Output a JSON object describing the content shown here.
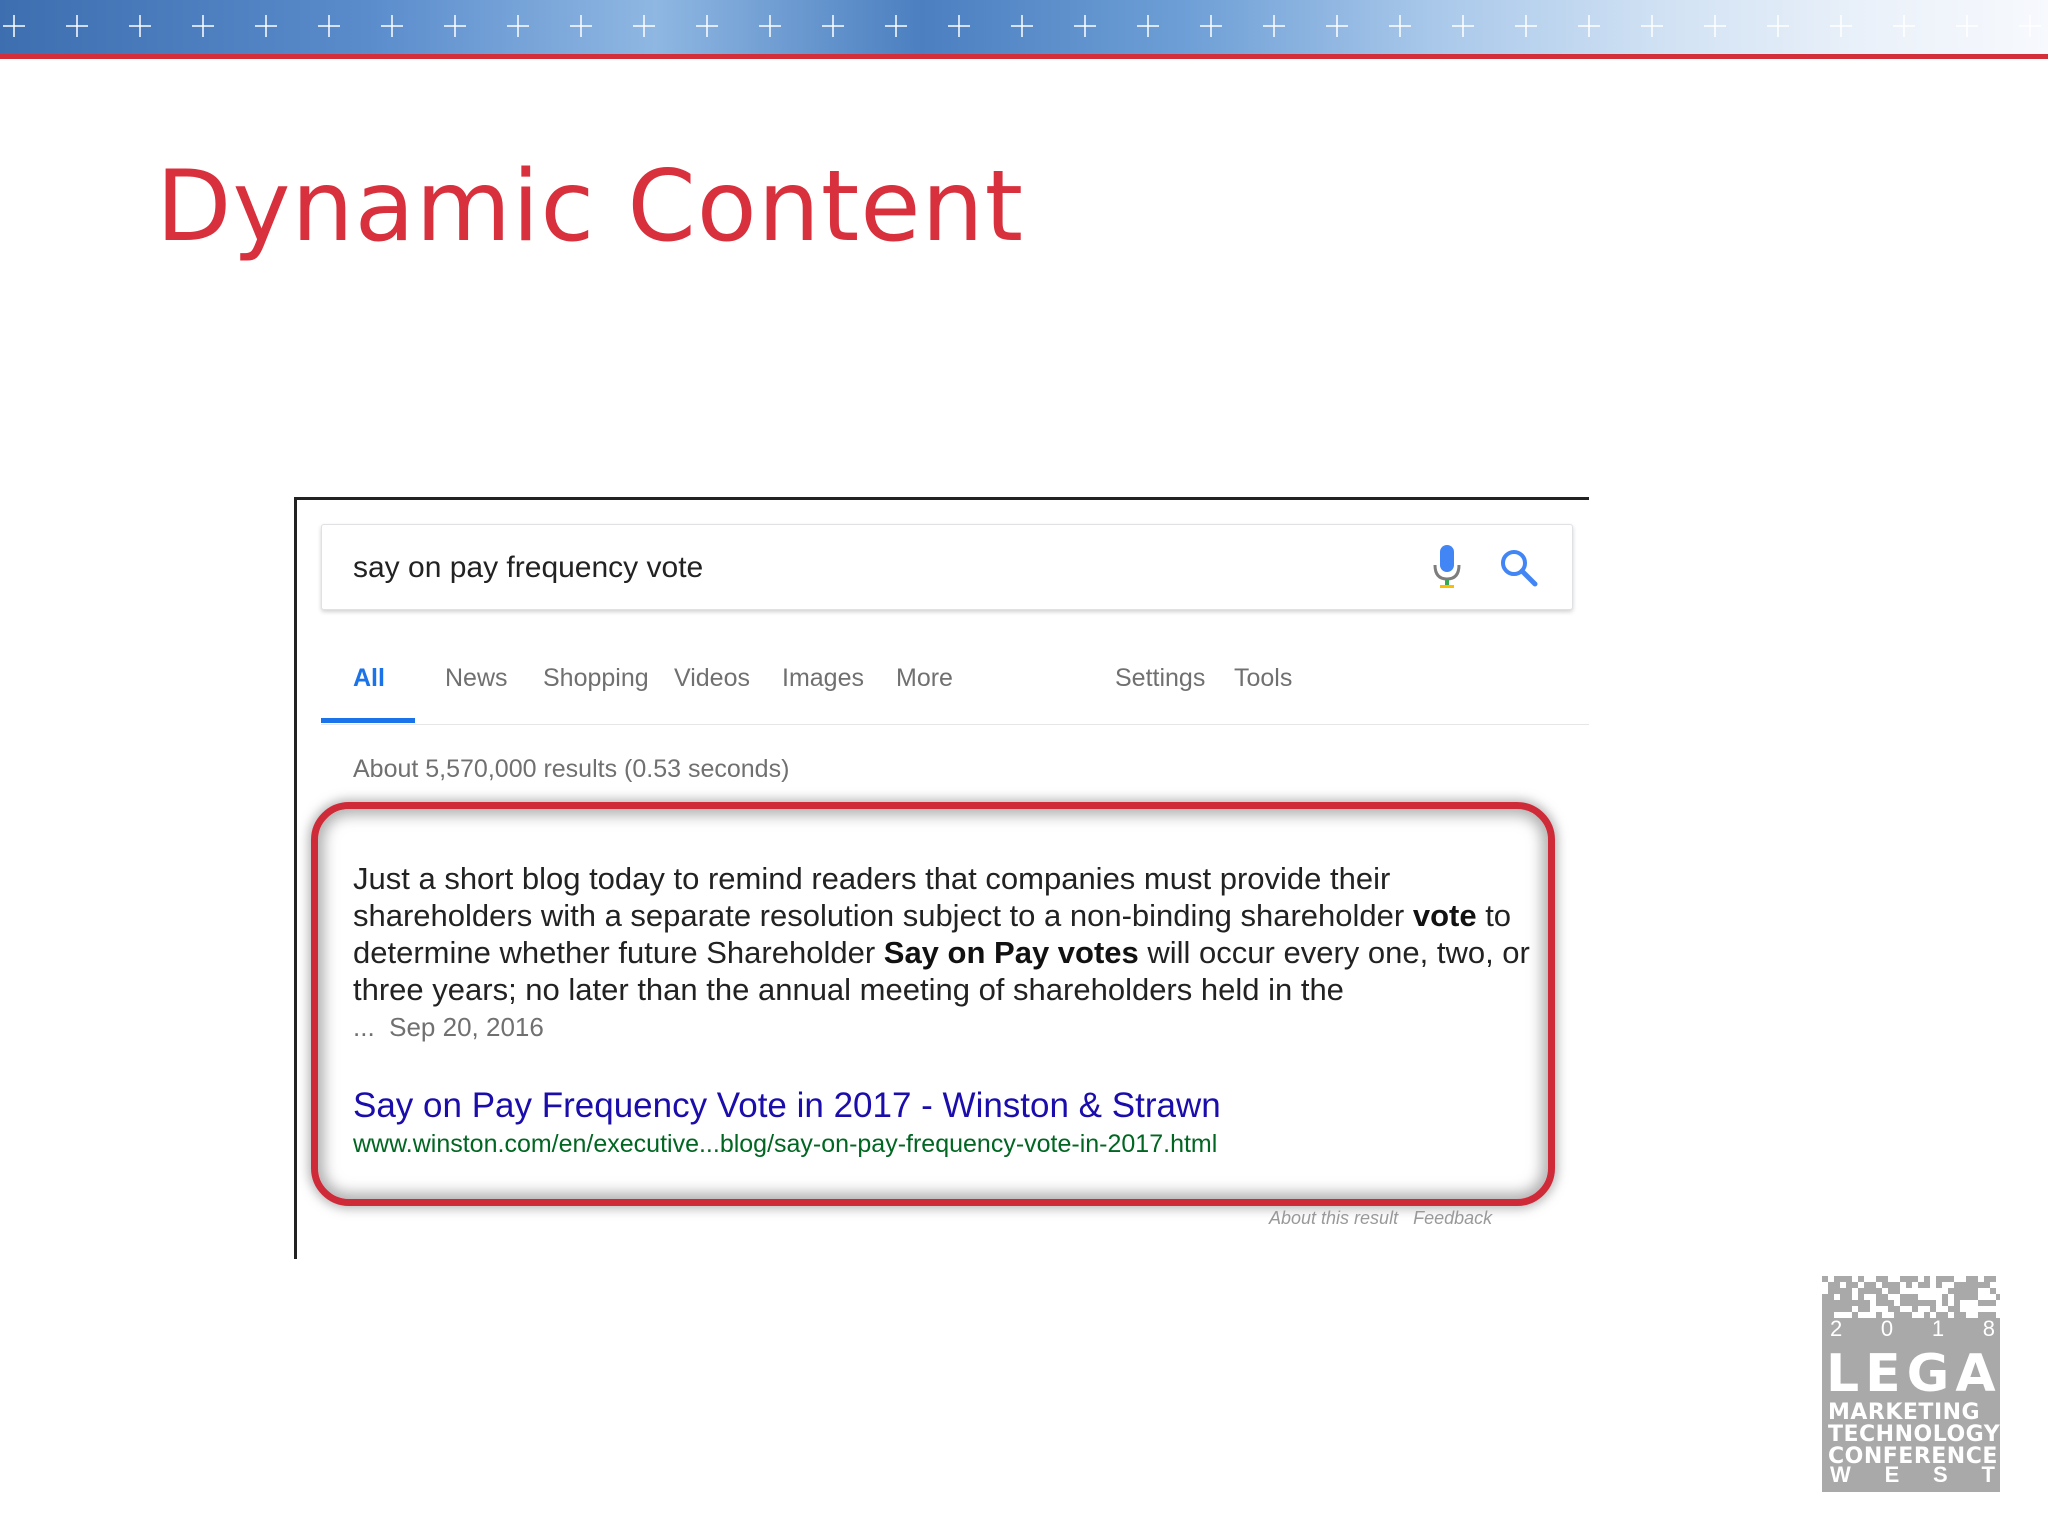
{
  "slide": {
    "title": "Dynamic Content"
  },
  "search": {
    "query": "say on pay frequency vote"
  },
  "tabs": {
    "all": "All",
    "news": "News",
    "shopping": "Shopping",
    "videos": "Videos",
    "images": "Images",
    "more": "More",
    "settings": "Settings",
    "tools": "Tools"
  },
  "stats": "About 5,570,000 results (0.53 seconds)",
  "snippet": {
    "p1": "Just a short blog today to remind readers that companies must provide their shareholders with a separate resolution subject to a non-binding shareholder ",
    "b1": "vote",
    "p2": " to determine whether future Shareholder ",
    "b2": "Say on Pay votes",
    "p3": " will occur every one, two, or three years; no later than the annual meeting of shareholders held in the",
    "ellipsis": "...",
    "date": "Sep 20, 2016"
  },
  "result": {
    "title": "Say on Pay Frequency Vote in 2017 - Winston & Strawn",
    "url": "www.winston.com/en/executive...blog/say-on-pay-frequency-vote-in-2017.html"
  },
  "about": {
    "about_label": "About this result",
    "feedback_label": "Feedback"
  },
  "logo": {
    "year_digits": [
      "2",
      "0",
      "1",
      "8"
    ],
    "legal": "LEGAL",
    "line1": "MARKETING",
    "line2": "TECHNOLOGY",
    "line3": "CONFERENCE",
    "west_letters": [
      "W",
      "E",
      "S",
      "T"
    ]
  },
  "colors": {
    "accent_red": "#d8303c",
    "link_blue": "#1a0dab",
    "url_green": "#006621",
    "tab_blue": "#1a73e8"
  },
  "icons": [
    "microphone-icon",
    "search-icon"
  ]
}
